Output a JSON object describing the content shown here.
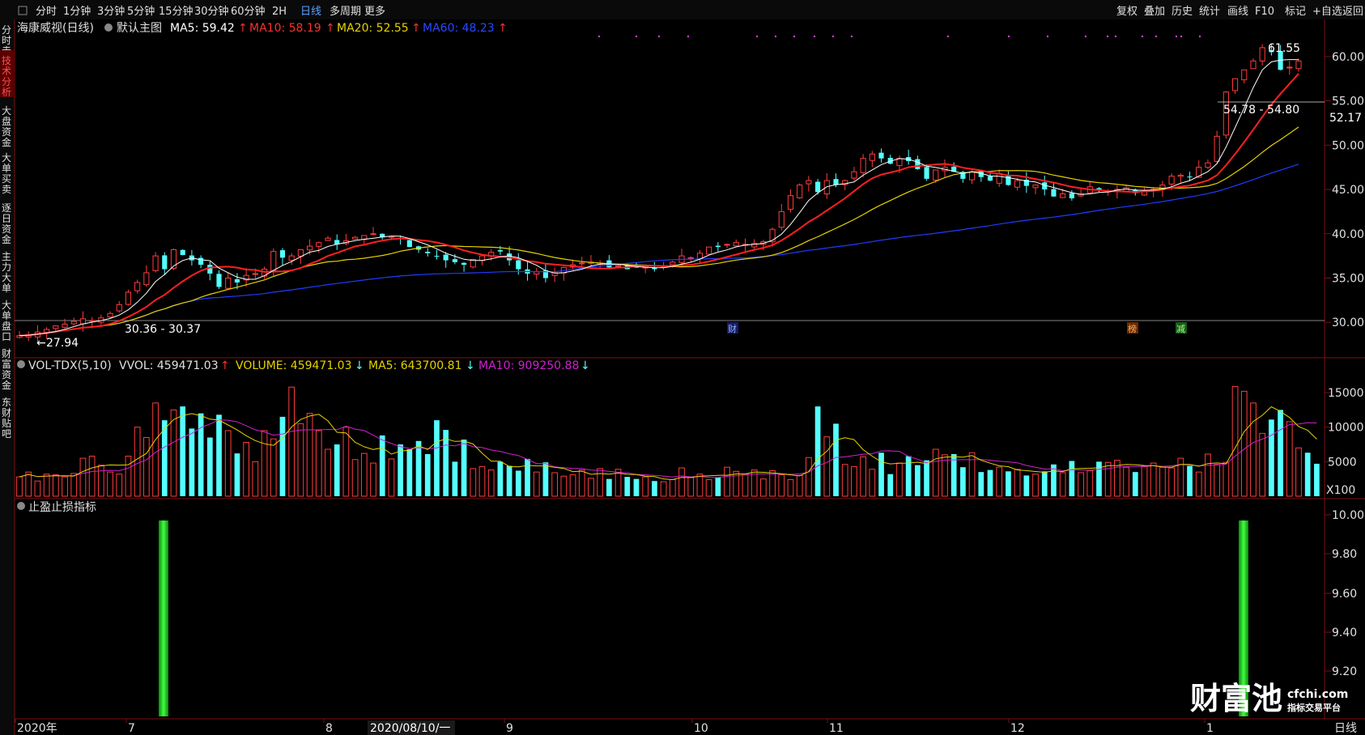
{
  "toolbar": {
    "periods": [
      "分时",
      "1分钟",
      "3分钟",
      "5分钟",
      "15分钟",
      "30分钟",
      "60分钟",
      "2H",
      "日线",
      "多周期",
      "更多"
    ],
    "active_period": "日线",
    "right_tools": [
      "复权",
      "叠加",
      "历史",
      "统计",
      "画线",
      "F10",
      "标记",
      "+自选",
      "返回"
    ]
  },
  "side_tabs": [
    "分时走势",
    "技术分析",
    "大盘资金",
    "大单买卖",
    "逐日资金",
    "主力大单",
    "大单盘口",
    "财富资金",
    "东财贴吧"
  ],
  "price_panel": {
    "stock_name": "海康威视(日线)",
    "indicator_name": "默认主图",
    "ma5_label": "MA5: 59.42",
    "ma10_label": "MA10: 58.19",
    "ma20_label": "MA20: 52.55",
    "ma60_label": "MA60: 48.23",
    "up_arrow": "↑",
    "y_ticks": [
      "60.00",
      "55.00",
      "50.00",
      "45.00",
      "40.00",
      "35.00",
      "30.00"
    ],
    "current_price_tag": "52.17",
    "annotation_high": "61.55",
    "annotation_low": "27.94",
    "annotation_range1": "54.78 - 54.80",
    "annotation_range2": "30.36 - 30.37",
    "event_markers": [
      "财",
      "榜",
      "减"
    ]
  },
  "volume_panel": {
    "title": "VOL-TDX(5,10)",
    "vvol_label": "VVOL: 459471.03",
    "vvol_arrow": "↑",
    "volume_label": "VOLUME: 459471.03",
    "volume_arrow": "↓",
    "ma5_label": "MA5: 643700.81",
    "ma5_arrow": "↓",
    "ma10_label": "MA10: 909250.88",
    "ma10_arrow": "↓",
    "y_ticks": [
      "15000",
      "10000",
      "5000"
    ],
    "unit": "X100"
  },
  "indicator_panel": {
    "title": "止盈止损指标",
    "y_ticks": [
      "10.00",
      "9.80",
      "9.60",
      "9.40",
      "9.20"
    ]
  },
  "x_axis": {
    "labels": [
      "2020年",
      "7",
      "8",
      "9",
      "10",
      "11",
      "12",
      "1"
    ],
    "cursor_date": "2020/08/10/一",
    "period_label": "日线"
  },
  "watermark": {
    "brand_cn": "财富池",
    "brand_en": "cfchi.com",
    "tagline": "指标交易平台"
  },
  "colors": {
    "up": "#ff3c3c",
    "down": "#54ffff",
    "ma5": "#ffffff",
    "ma10": "#ff2020",
    "ma20": "#e6d200",
    "ma60": "#1f3cff",
    "vol_ma5": "#e6d200",
    "vol_ma10": "#d020d0",
    "signal": "#20d020"
  },
  "chart_data": {
    "type": "candlestick",
    "title": "海康威视(日线)",
    "x_range": [
      "2020-06-29",
      "2021-01-15"
    ],
    "price_ylim": [
      26,
      63
    ],
    "price_min": 27.94,
    "price_max": 61.55,
    "series": [
      {
        "name": "MA5",
        "last": 59.42
      },
      {
        "name": "MA10",
        "last": 58.19
      },
      {
        "name": "MA20",
        "last": 52.55
      },
      {
        "name": "MA60",
        "last": 48.23
      }
    ],
    "close_approx": [
      28.5,
      28.6,
      28.9,
      29.2,
      29.6,
      29.8,
      30.1,
      30.4,
      30.2,
      30.5,
      31.0,
      32.0,
      33.4,
      34.5,
      35.6,
      37.5,
      36.0,
      38.2,
      37.6,
      37.0,
      36.5,
      35.5,
      34.0,
      35.0,
      34.5,
      35.3,
      35.5,
      36.0,
      38.0,
      37.3,
      37.5,
      38.2,
      38.6,
      39.0,
      39.5,
      38.8,
      39.2,
      39.6,
      39.8,
      40.0,
      39.6,
      39.7,
      39.5,
      38.5,
      38.2,
      37.8,
      37.5,
      37.0,
      36.8,
      36.5,
      37.1,
      37.5,
      37.9,
      38.0,
      37.0,
      36.0,
      35.5,
      35.7,
      35.0,
      35.6,
      36.2,
      36.5,
      36.7,
      36.8,
      36.7,
      36.2,
      36.4,
      36.0,
      36.2,
      36.3,
      36.0,
      36.3,
      36.8,
      37.5,
      37.3,
      37.8,
      38.5,
      38.5,
      38.8,
      39.0,
      38.8,
      38.9,
      39.1,
      40.5,
      42.5,
      44.3,
      45.5,
      46.0,
      44.7,
      46.0,
      45.5,
      46.0,
      47.0,
      48.5,
      49.0,
      48.5,
      47.9,
      48.5,
      48.2,
      47.3,
      46.2,
      47.2,
      47.5,
      47.0,
      46.2,
      47.0,
      46.4,
      46.0,
      46.8,
      45.5,
      46.0,
      45.4,
      45.5,
      45.0,
      44.2,
      44.5,
      44.0,
      44.5,
      45.3,
      45.0,
      44.8,
      45.0,
      45.2,
      44.6,
      44.9,
      45.0,
      45.5,
      46.5,
      46.6,
      46.4,
      47.5,
      48.0,
      51.0,
      56.0,
      57.5,
      58.5,
      59.5,
      61.0,
      60.5,
      58.5,
      58.8,
      59.5
    ],
    "volume_ylim": [
      0,
      17000
    ],
    "volume_approx": [
      2800,
      3500,
      2200,
      3200,
      3100,
      2800,
      3300,
      5500,
      5800,
      4500,
      3500,
      3200,
      5800,
      10000,
      8500,
      13500,
      11000,
      12500,
      13000,
      9800,
      12000,
      8500,
      11800,
      9500,
      6200,
      7800,
      5000,
      9500,
      8300,
      11500,
      15800,
      10500,
      12000,
      9500,
      6800,
      7500,
      10000,
      5300,
      6200,
      4800,
      8800,
      5400,
      7500,
      6800,
      8000,
      6100,
      11000,
      9600,
      5000,
      8200,
      4000,
      4300,
      3800,
      5000,
      4400,
      3700,
      5400,
      3500,
      4900,
      3400,
      2900,
      3100,
      3800,
      2600,
      4000,
      2500,
      3900,
      2800,
      2500,
      2800,
      2200,
      2100,
      2400,
      4100,
      2700,
      3200,
      2400,
      2700,
      4200,
      3600,
      3200,
      3800,
      2500,
      3700,
      3100,
      2400,
      3000,
      5600,
      13000,
      8600,
      10500,
      4600,
      4300,
      5700,
      3900,
      6300,
      3200,
      4800,
      5800,
      4500,
      5200,
      6800,
      6000,
      6100,
      4200,
      6300,
      3500,
      3800,
      4200,
      3600,
      3900,
      3000,
      3200,
      3600,
      4600,
      3400,
      5100,
      3400,
      3700,
      5000,
      4900,
      5200,
      4200,
      3500,
      4400,
      4800,
      4200,
      4100,
      5500,
      4400,
      3500,
      6100,
      4600,
      4900,
      15900,
      15200,
      13500,
      9100,
      11100,
      12500,
      10800,
      7000,
      6300,
      4700
    ]
  }
}
